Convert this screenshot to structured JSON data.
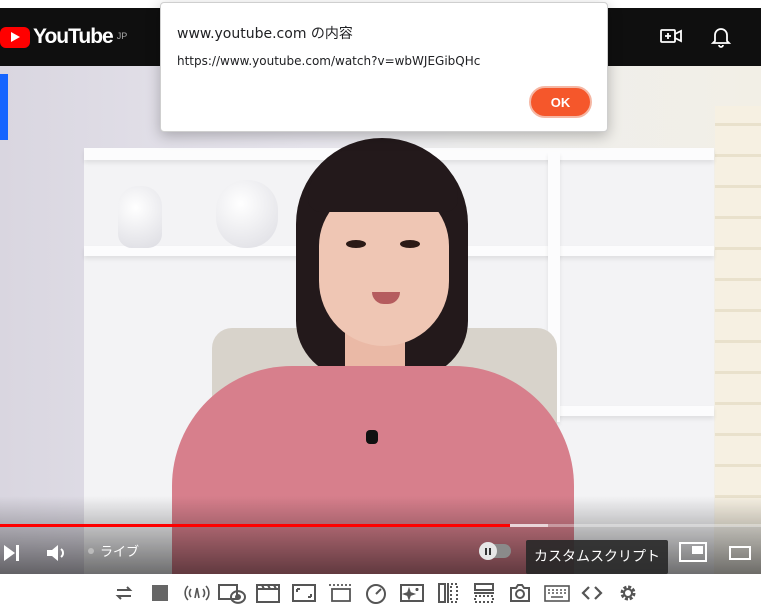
{
  "header": {
    "logo_text": "YouTube",
    "region": "JP",
    "icons": [
      "create-video-icon",
      "bell-icon"
    ]
  },
  "dialog": {
    "title": "www.youtube.com の内容",
    "message": "https://www.youtube.com/watch?v=wbWJEGibQHc",
    "ok_label": "OK",
    "accent": "#f5572b"
  },
  "player": {
    "live_label": "ライブ",
    "progress_played": 0.67,
    "progress_loaded": 0.72,
    "tooltip": "カスタムスクリプト",
    "progress_color": "#ff0000"
  },
  "toolbar": {
    "icons": [
      "loop-icon",
      "stop-icon",
      "broadcast-icon",
      "video-eye-icon",
      "clapperboard-icon",
      "resize-corners-icon",
      "frame-dashed-icon",
      "speedometer-icon",
      "sparkle-box-icon",
      "split-vertical-icon",
      "split-horizontal-icon",
      "camera-icon",
      "keyboard-icon",
      "code-icon",
      "gear-icon"
    ]
  }
}
